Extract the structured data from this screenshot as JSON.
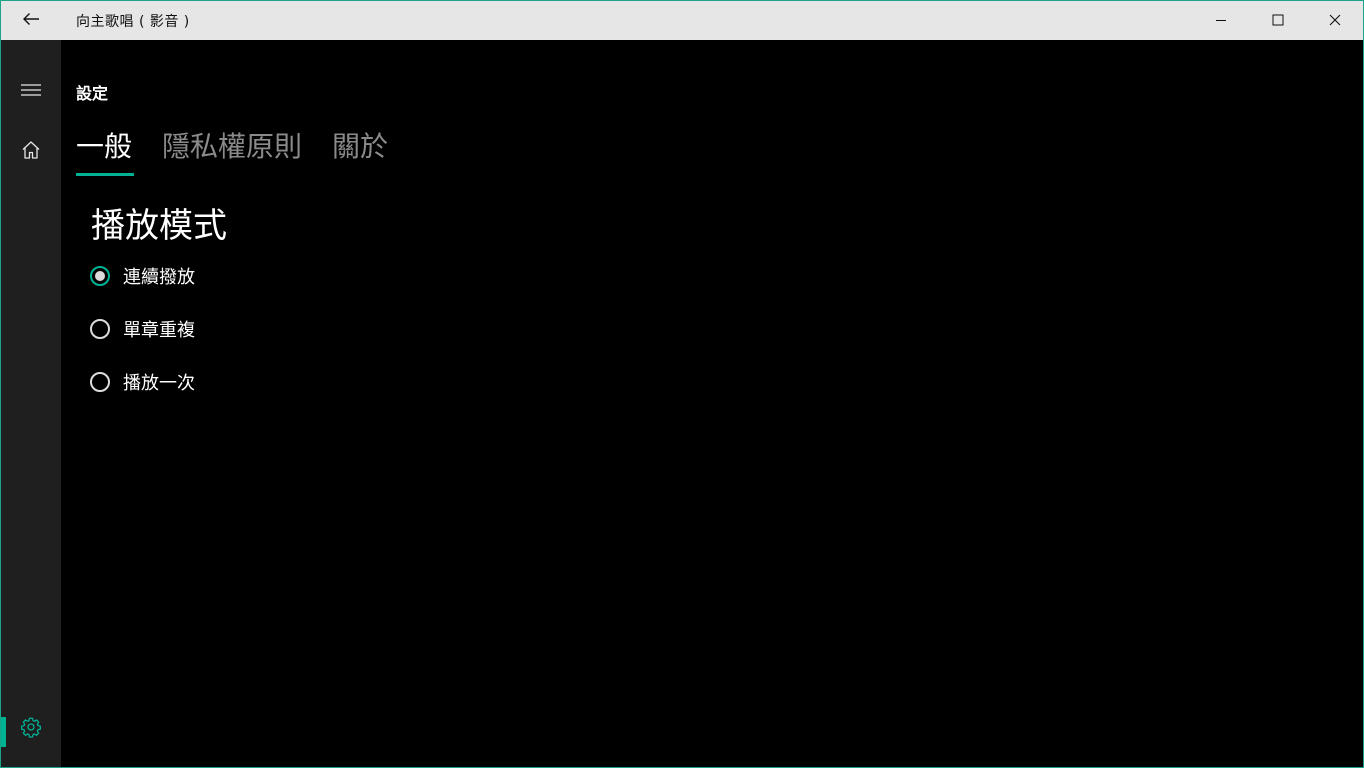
{
  "window": {
    "title": "向主歌唱 ( 影音 )"
  },
  "titlebar": {
    "back_icon": "back-arrow-icon",
    "minimize_icon": "minimize-icon",
    "maximize_icon": "maximize-icon",
    "close_icon": "close-icon"
  },
  "sidebar": {
    "menu_icon": "hamburger-menu-icon",
    "home_icon": "home-icon",
    "settings_icon": "gear-icon",
    "selected_item": "settings"
  },
  "page": {
    "title": "設定",
    "tabs": [
      {
        "label": "一般",
        "active": true
      },
      {
        "label": "隱私權原則",
        "active": false
      },
      {
        "label": "關於",
        "active": false
      }
    ],
    "section_title": "播放模式",
    "play_modes": [
      {
        "label": "連續撥放",
        "checked": true
      },
      {
        "label": "單章重複",
        "checked": false
      },
      {
        "label": "播放一次",
        "checked": false
      }
    ]
  },
  "colors": {
    "accent": "#00b294",
    "titlebar_bg": "#e6e6e6",
    "sidebar_bg": "#1f1f1f",
    "content_bg": "#000000",
    "inactive_tab": "#8a8a8a"
  }
}
